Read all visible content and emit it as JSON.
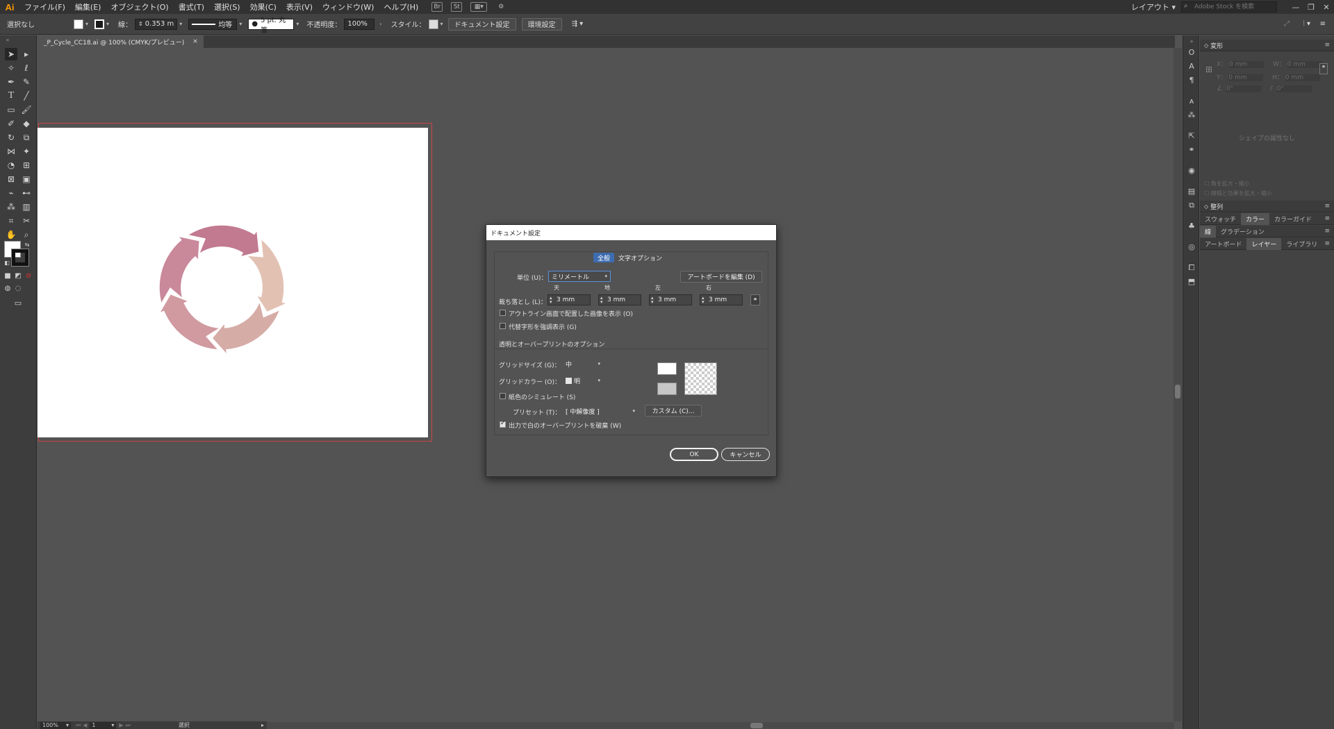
{
  "app": {
    "logo": "Ai",
    "workspace": "レイアウト",
    "stock_placeholder": "Adobe Stock を検索"
  },
  "menu": [
    "ファイル(F)",
    "編集(E)",
    "オブジェクト(O)",
    "書式(T)",
    "選択(S)",
    "効果(C)",
    "表示(V)",
    "ウィンドウ(W)",
    "ヘルプ(H)"
  ],
  "menu_buttons": {
    "bridge": "Br",
    "stock": "St"
  },
  "controlbar": {
    "selection": "選択なし",
    "stroke_label": "線：",
    "stroke_value": "0.353 m",
    "profile": "均等",
    "brush": "5 pt. 丸筆",
    "opacity_label": "不透明度：",
    "opacity_value": "100%",
    "style_label": "スタイル：",
    "doc_setup_btn": "ドキュメント設定",
    "prefs_btn": "環境設定"
  },
  "document_tab": {
    "title": "_P_Cycle_CC18.ai @ 100% (CMYK/プレビュー)",
    "close": "×"
  },
  "statusbar": {
    "zoom": "100%",
    "artboard": "1",
    "mode": "選択"
  },
  "right_panels": {
    "transform": {
      "title": "変形",
      "x_label": "X：",
      "x_value": "0 mm",
      "w_label": "W：",
      "w_value": "0 mm",
      "y_label": "Y：",
      "y_value": "0 mm",
      "h_label": "H：",
      "h_value": "0 mm",
      "angle": "0°",
      "shear": "0°",
      "no_props": "シェイプの属性なし",
      "scale_corners": "角を拡大・縮小",
      "scale_strokes": "線幅と効果を拡大・縮小"
    },
    "align_title": "整列",
    "tabs_row1": [
      "スウォッチ",
      "カラー",
      "カラーガイド"
    ],
    "tabs_row2": [
      "線",
      "グラデーション"
    ],
    "tabs_row3": [
      "アートボード",
      "レイヤー",
      "ライブラリ"
    ]
  },
  "dialog": {
    "title": "ドキュメント設定",
    "tab_general": "全般",
    "tab_type": "文字オプション",
    "units_label": "単位 (U)：",
    "units_value": "ミリメートル",
    "edit_artboards_btn": "アートボードを編集 (D)",
    "bleed_label": "裁ち落とし (L)：",
    "bleed_top_label": "天",
    "bleed_bottom_label": "地",
    "bleed_left_label": "左",
    "bleed_right_label": "右",
    "bleed_top": "3 mm",
    "bleed_bottom": "3 mm",
    "bleed_left": "3 mm",
    "bleed_right": "3 mm",
    "show_images_outline": "アウトライン画面で配置した画像を表示 (O)",
    "highlight_glyphs": "代替字形を強調表示 (G)",
    "transparency_section": "透明とオーバープリントのオプション",
    "grid_size_label": "グリッドサイズ (G)：",
    "grid_size_value": "中",
    "grid_color_label": "グリッドカラー (O)：",
    "grid_color_value": "明",
    "simulate_paper": "紙色のシミュレート (S)",
    "preset_label": "プリセット (T)：",
    "preset_value": "[ 中解像度 ]",
    "custom_btn": "カスタム (C)...",
    "discard_white_overprint": "出力で白のオーバープリントを破棄 (W)",
    "ok": "OK",
    "cancel": "キャンセル",
    "checked": {
      "show_images_outline": false,
      "highlight_glyphs": false,
      "simulate_paper": false,
      "discard_white_overprint": true
    }
  },
  "colors": {
    "cycle_a": "#c27a90",
    "cycle_b": "#e2c1b3",
    "cycle_c": "#d6aca6",
    "cycle_d": "#d09aa0",
    "cycle_e": "#c9899a",
    "accent_tab": "#3d6cb0"
  }
}
